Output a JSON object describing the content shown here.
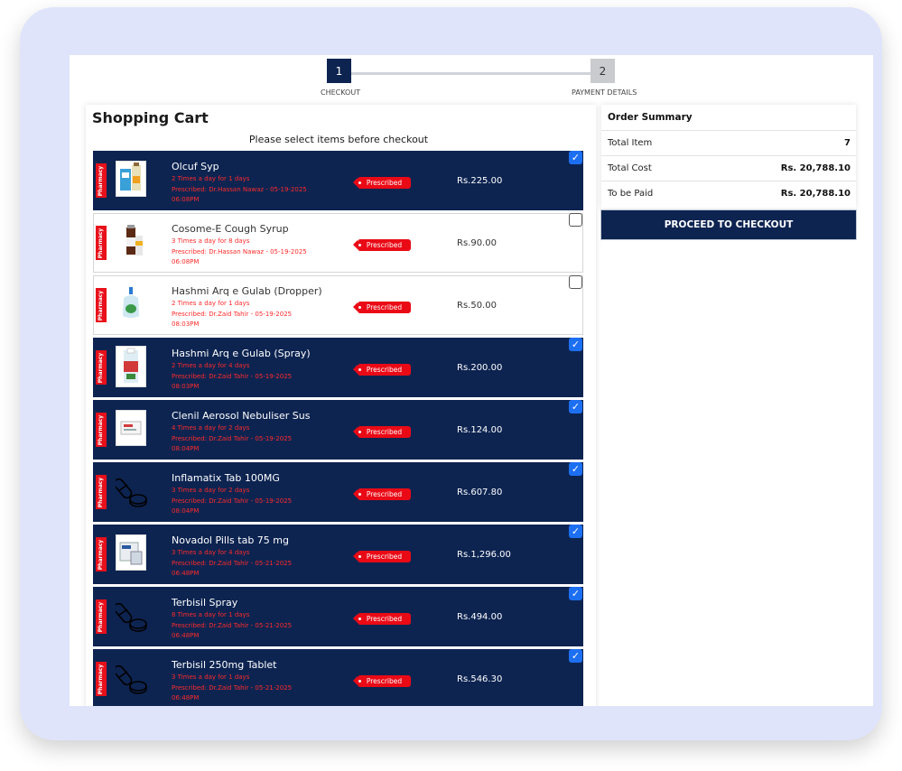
{
  "stepper": {
    "steps": [
      {
        "number": "1",
        "label": "CHECKOUT",
        "active": true
      },
      {
        "number": "2",
        "label": "PAYMENT DETAILS",
        "active": false
      }
    ]
  },
  "cart": {
    "title": "Shopping Cart",
    "subtitle": "Please select items before checkout",
    "badge_label": "Pharmacy",
    "prescribed_label": "Prescribed",
    "items": [
      {
        "name": "Olcuf Syp",
        "dosage": "2 Times a day for 1 days",
        "prescribed_by": "Prescribed: Dr.Hassan Nawaz - 05-19-2025",
        "time": "06:08PM",
        "price": "Rs.225.00",
        "selected": true,
        "image": "syrup-box-photo"
      },
      {
        "name": "Cosome-E Cough Syrup",
        "dosage": "3 Times a day for 8 days",
        "prescribed_by": "Prescribed: Dr.Hassan Nawaz - 05-19-2025",
        "time": "06:08PM",
        "price": "Rs.90.00",
        "selected": false,
        "image": "cough-syrup-photo"
      },
      {
        "name": "Hashmi Arq e Gulab (Dropper)",
        "dosage": "2 Times a day for 1 days",
        "prescribed_by": "Prescribed: Dr.Zaid Tahir - 05-19-2025",
        "time": "08:03PM",
        "price": "Rs.50.00",
        "selected": false,
        "image": "dropper-bottle-photo"
      },
      {
        "name": "Hashmi Arq e Gulab (Spray)",
        "dosage": "2 Times a day for 4 days",
        "prescribed_by": "Prescribed: Dr.Zaid Tahir - 05-19-2025",
        "time": "08:03PM",
        "price": "Rs.200.00",
        "selected": true,
        "image": "spray-bottle-photo"
      },
      {
        "name": "Clenil Aerosol Nebuliser Sus",
        "dosage": "4 Times a day for 2 days",
        "prescribed_by": "Prescribed: Dr.Zaid Tahir - 05-19-2025",
        "time": "08:04PM",
        "price": "Rs.124.00",
        "selected": true,
        "image": "nebuliser-box-photo"
      },
      {
        "name": "Inflamatix Tab 100MG",
        "dosage": "3 Times a day for 2 days",
        "prescribed_by": "Prescribed: Dr.Zaid Tahir - 05-19-2025",
        "time": "08:04PM",
        "price": "Rs.607.80",
        "selected": true,
        "image": "pills-icon"
      },
      {
        "name": "Novadol Pills tab 75 mg",
        "dosage": "3 Times a day for 4 days",
        "prescribed_by": "Prescribed: Dr.Zaid Tahir - 05-21-2025",
        "time": "06:48PM",
        "price": "Rs.1,296.00",
        "selected": true,
        "image": "tablet-box-photo"
      },
      {
        "name": "Terbisil Spray",
        "dosage": "8 Times a day for 1 days",
        "prescribed_by": "Prescribed: Dr.Zaid Tahir - 05-21-2025",
        "time": "06:48PM",
        "price": "Rs.494.00",
        "selected": true,
        "image": "pills-icon"
      },
      {
        "name": "Terbisil 250mg Tablet",
        "dosage": "3 Times a day for 1 days",
        "prescribed_by": "Prescribed: Dr.Zaid Tahir - 05-21-2025",
        "time": "06:48PM",
        "price": "Rs.546.30",
        "selected": true,
        "image": "pills-icon"
      }
    ]
  },
  "summary": {
    "title": "Order Summary",
    "rows": [
      {
        "label": "Total Item",
        "value": "7"
      },
      {
        "label": "Total Cost",
        "value": "Rs. 20,788.10"
      },
      {
        "label": "To be Paid",
        "value": "Rs. 20,788.10"
      }
    ],
    "checkout_label": "PROCEED TO CHECKOUT"
  },
  "colors": {
    "navy": "#0d2451",
    "red": "#ea0a16",
    "checkbox_blue": "#1d6ff2",
    "frame": "#dfe4fb"
  }
}
